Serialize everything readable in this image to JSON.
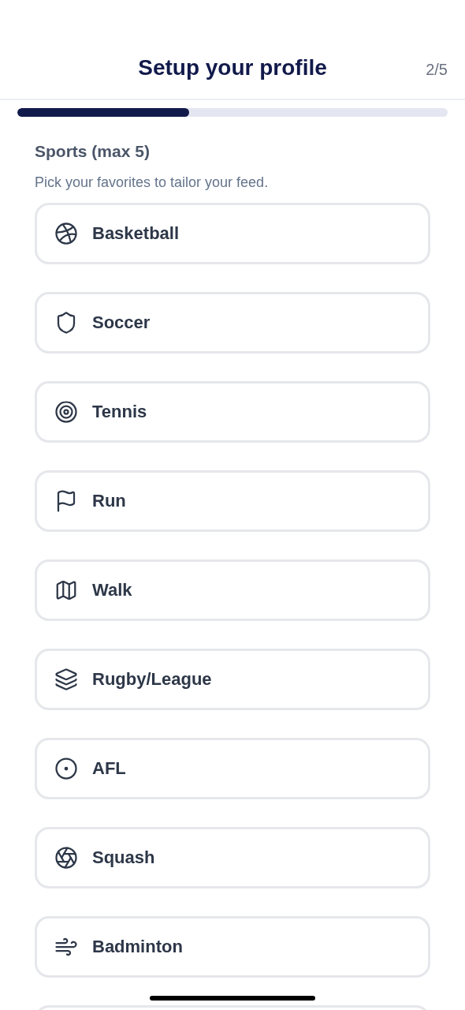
{
  "header": {
    "title": "Setup your profile",
    "step": "2/5"
  },
  "progress": {
    "level": 0.4
  },
  "section": {
    "title": "Sports (max 5)",
    "subtitle": "Pick your favorites to tailor your feed."
  },
  "sports": [
    {
      "label": "Basketball",
      "selected": false
    },
    {
      "label": "Soccer",
      "selected": false
    },
    {
      "label": "Tennis",
      "selected": false
    },
    {
      "label": "Run",
      "selected": false
    },
    {
      "label": "Walk",
      "selected": false
    },
    {
      "label": "Rugby/League",
      "selected": false
    },
    {
      "label": "AFL",
      "selected": false
    },
    {
      "label": "Squash",
      "selected": false
    },
    {
      "label": "Badminton",
      "selected": false
    }
  ]
}
